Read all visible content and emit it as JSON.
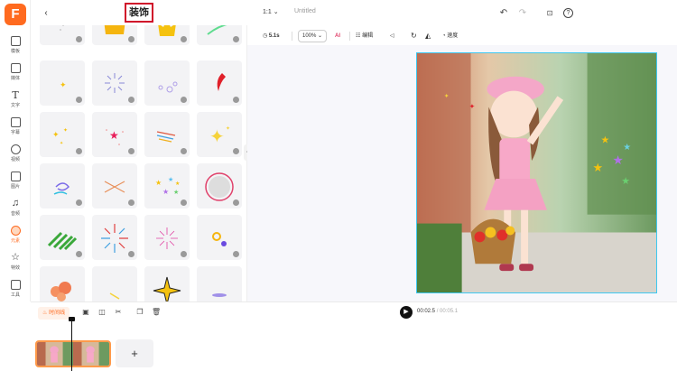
{
  "app": {
    "logo_letter": "F"
  },
  "rail": {
    "items": [
      {
        "label": "模板",
        "icon": "template-icon"
      },
      {
        "label": "媒体",
        "icon": "media-icon"
      },
      {
        "label": "文字",
        "icon": "text-icon"
      },
      {
        "label": "字幕",
        "icon": "subtitle-icon"
      },
      {
        "label": "视频",
        "icon": "video-icon"
      },
      {
        "label": "图片",
        "icon": "image-icon"
      },
      {
        "label": "音频",
        "icon": "audio-icon"
      },
      {
        "label": "元素",
        "icon": "element-icon",
        "active": true
      },
      {
        "label": "特效",
        "icon": "effects-icon"
      },
      {
        "label": "工具",
        "icon": "tools-icon"
      }
    ]
  },
  "panel": {
    "title": "装饰",
    "back_icon": "chevron-left-icon",
    "add_icon": "plus-icon"
  },
  "topbar": {
    "ratio": "1:1",
    "project_name": "Untitled",
    "undo_icon": "undo-icon",
    "redo_icon": "redo-icon",
    "screenshot_icon": "capture-icon",
    "help": "?"
  },
  "tools": {
    "duration": "5.1s",
    "zoom": "100%",
    "ai": "AI",
    "edit": "编辑",
    "speed": "速度"
  },
  "timeline": {
    "label": "时间线",
    "current_time": "00:02.5",
    "total_time": "/ 00:05.1",
    "add_label": "+"
  },
  "colors": {
    "accent": "#ff6a1f",
    "selection": "#3ec8f0",
    "title_box": "#d0102a"
  }
}
